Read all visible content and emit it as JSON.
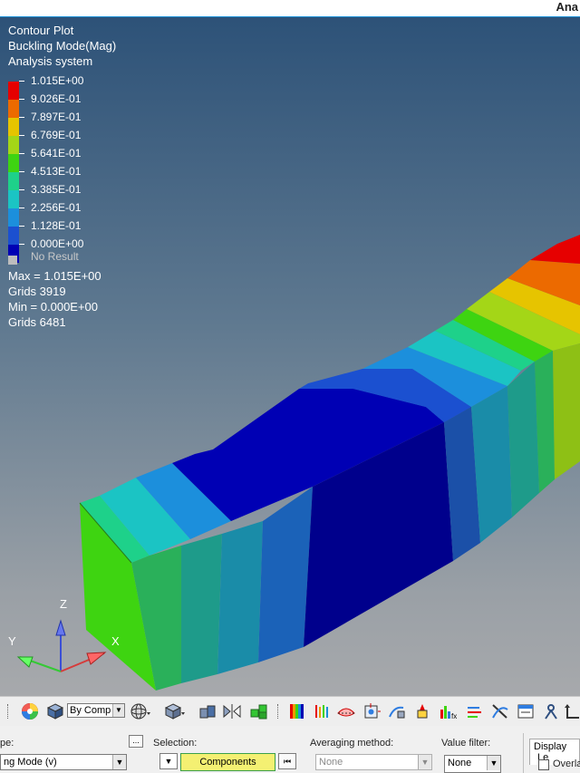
{
  "window": {
    "title_fragment": "Ana"
  },
  "legend": {
    "title": "Contour Plot",
    "result": "Buckling Mode(Mag)",
    "system": "Analysis system",
    "colors": [
      "#e60000",
      "#ec6a00",
      "#e6c400",
      "#a4d617",
      "#3ed411",
      "#1ed18a",
      "#1bc4c4",
      "#1c8fdc",
      "#1b50d0",
      "#0000b4"
    ],
    "labels": [
      "1.015E+00",
      "9.026E-01",
      "7.897E-01",
      "6.769E-01",
      "5.641E-01",
      "4.513E-01",
      "3.385E-01",
      "2.256E-01",
      "1.128E-01",
      "0.000E+00"
    ],
    "no_result": "No Result",
    "max": "Max = 1.015E+00",
    "max_grids": "Grids 3919",
    "min": "Min = 0.000E+00",
    "min_grids": "Grids 6481"
  },
  "triad": {
    "z": "Z",
    "y": "Y",
    "x": "X"
  },
  "toolbar": {
    "by_comp": "By Comp",
    "icons": [
      "color-wheel-icon",
      "shaded-cube-icon",
      "by-comp-select",
      "wireframe-sphere-icon",
      "shaded-box-icon",
      "box-pair-icon",
      "mirror-icon",
      "green-cubes-icon",
      "contour-icon",
      "iso-contour-icon",
      "deformed-icon",
      "vector-icon",
      "tensor-icon",
      "marker-icon",
      "graph-icon",
      "streamline-icon",
      "section-icon",
      "notes-icon",
      "query-icon",
      "measure-icon"
    ]
  },
  "panel": {
    "result_type_label": "pe:",
    "result_type_value": "ng Mode (v)",
    "selection_label": "Selection:",
    "selection_value": "Components",
    "averaging_label": "Averaging method:",
    "averaging_value": "None",
    "value_filter_label": "Value filter:",
    "value_filter_value": "None",
    "display_tab": "Display",
    "legend_tab": "Le",
    "overlay_label": "Overla"
  }
}
